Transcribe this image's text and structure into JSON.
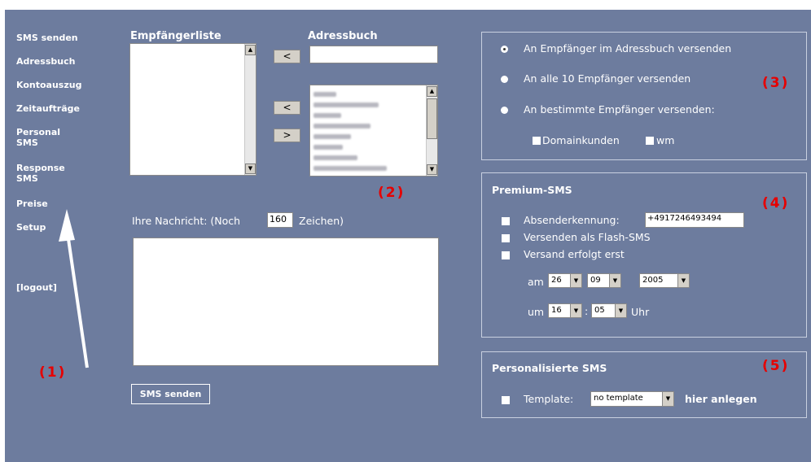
{
  "nav": {
    "items": [
      {
        "label": "SMS senden"
      },
      {
        "label": "Adressbuch"
      },
      {
        "label": "Kontoauszug"
      },
      {
        "label": "Zeitaufträge"
      },
      {
        "label": "Personal SMS"
      },
      {
        "label": "Response SMS"
      },
      {
        "label": "Preise"
      },
      {
        "label": "Setup"
      }
    ],
    "logout_label": "[logout]"
  },
  "annotations": {
    "n1": "(1)",
    "n2": "(2)",
    "n3": "(3)",
    "n4": "(4)",
    "n5": "(5)"
  },
  "recipients": {
    "heading": "Empfängerliste"
  },
  "addressbook": {
    "heading": "Adressbuch",
    "search_value": ""
  },
  "transfer_buttons": {
    "add": "<",
    "add2": "<",
    "remove": ">"
  },
  "message": {
    "label_prefix": "Ihre Nachricht: (Noch",
    "remaining": "160",
    "label_suffix": "Zeichen)",
    "text": ""
  },
  "send_button": "SMS senden",
  "send_options": {
    "opt1": "An Empfänger im Adressbuch versenden",
    "opt2": "An alle 10 Empfänger versenden",
    "opt3": "An bestimmte Empfänger versenden:",
    "selected": "opt1",
    "group1": "Domainkunden",
    "group2": "wm"
  },
  "premium": {
    "heading": "Premium-SMS",
    "sender_label": "Absenderkennung:",
    "sender_value": "+4917246493494",
    "flash_label": "Versenden als Flash-SMS",
    "delayed_label": "Versand erfolgt erst",
    "am_label": "am",
    "day": "26",
    "month": "09",
    "year": "2005",
    "um_label": "um",
    "hour": "16",
    "minute": "05",
    "time_sep": ":",
    "uhr_label": "Uhr"
  },
  "personalized": {
    "heading": "Personalisierte SMS",
    "template_label": "Template:",
    "template_value": "no template",
    "create_link": "hier anlegen"
  }
}
